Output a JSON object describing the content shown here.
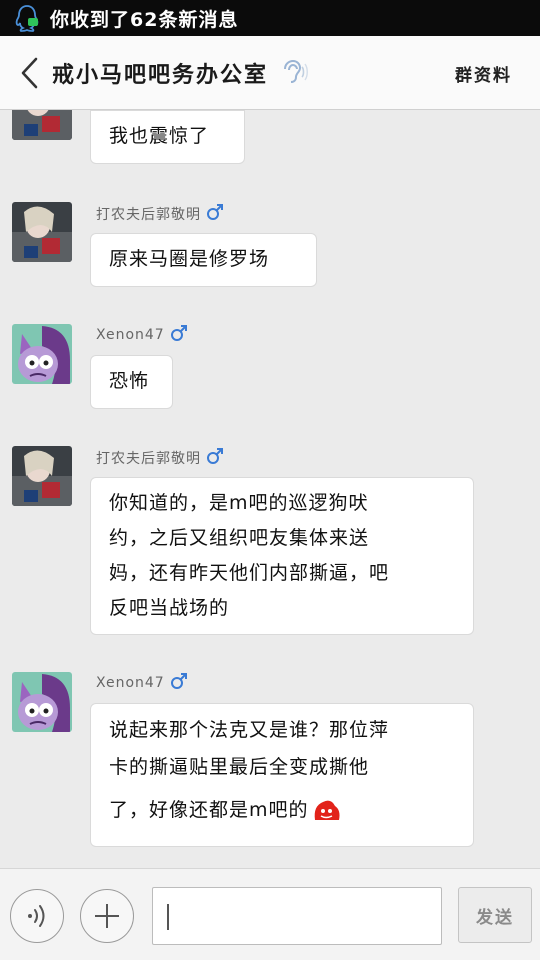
{
  "status_bar": {
    "notification": "你收到了62条新消息"
  },
  "header": {
    "title": "戒小马吧吧务办公室",
    "right_action": "群资料"
  },
  "messages": [
    {
      "sender": "",
      "text": "我也震惊了",
      "avatar": "avatar-a"
    },
    {
      "sender": "打农夫后郭敬明",
      "text": "原来马圈是修罗场",
      "avatar": "avatar-a"
    },
    {
      "sender": "Xenon47",
      "text": "恐怖",
      "avatar": "avatar-b"
    },
    {
      "sender": "打农夫后郭敬明",
      "text": "你知道的，是m吧的巡逻狗吠约，之后又组织吧友集体来送妈，还有昨天他们内部撕逼，吧友吧当战场的",
      "lines": [
        "你知道的，是m吧的巡逻狗吠",
        "约，之后又组织吧友集体来送",
        "妈，还有昨天他们内部撕逼，吧",
        "反吧当战场的"
      ],
      "avatar": "avatar-a"
    },
    {
      "sender": "Xenon47",
      "text": "说起来那个法克又是谁？那位萍卡的撕逼贴里最后全变成撕他了，好像还都是m吧的",
      "lines": [
        "说起来那个法克又是谁？那位萍",
        "卡的撕逼贴里最后全变成撕他",
        "了，好像还都是m吧的"
      ],
      "avatar": "avatar-b"
    }
  ],
  "input": {
    "send_label": "发送",
    "value": ""
  },
  "colors": {
    "status_bg": "#0b0b0b",
    "header_bg": "#fafafa",
    "chat_bg": "#ebebeb",
    "male_icon": "#3a7bd5"
  }
}
